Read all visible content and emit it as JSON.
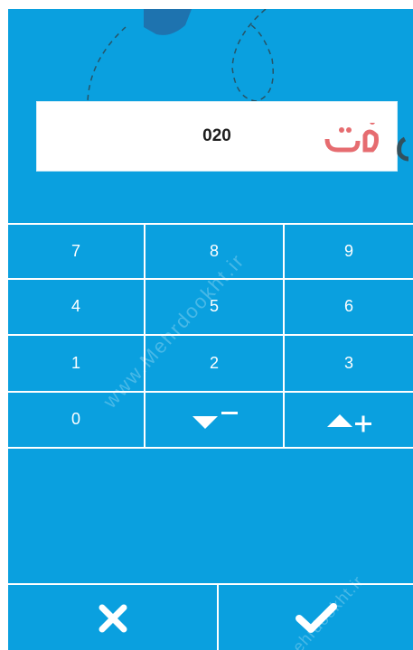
{
  "display": {
    "value": "020"
  },
  "keypad": {
    "keys": [
      "7",
      "8",
      "9",
      "4",
      "5",
      "6",
      "1",
      "2",
      "3",
      "0"
    ],
    "decrement_icon": "down-arrow-minus-icon",
    "increment_icon": "up-arrow-plus-icon"
  },
  "actions": {
    "cancel_icon": "x-icon",
    "confirm_icon": "check-icon"
  },
  "watermark": {
    "text": "www.Mehrdookht.ir",
    "text2": "mehrdookht.ir"
  },
  "colors": {
    "background": "#0aa0df",
    "divider": "#ffffff",
    "display_bg": "#ffffff"
  }
}
